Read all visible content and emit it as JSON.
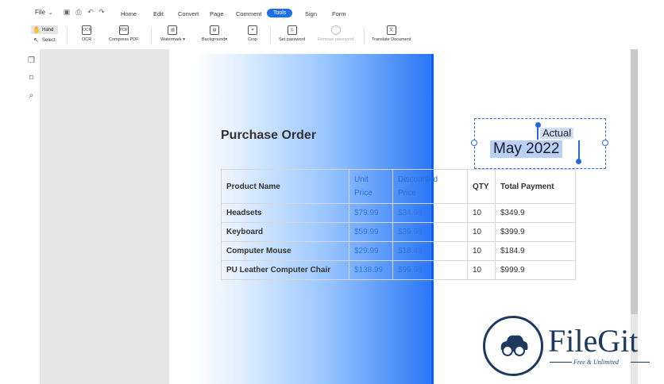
{
  "menubar": {
    "file_label": "File",
    "caret": "⌄",
    "quick_icons": [
      "save-icon",
      "print-icon",
      "undo-icon",
      "redo-icon"
    ],
    "items": [
      "Home",
      "Edit",
      "Convert",
      "Page",
      "Comment",
      "Tools",
      "Sign",
      "Form"
    ],
    "active": "Tools"
  },
  "toolbar": {
    "hand_label": "Hand",
    "select_label": "Select",
    "tools": [
      {
        "label": "OCR",
        "icon": "ocr-icon",
        "glyph": "OCR"
      },
      {
        "label": "Compress PDF",
        "icon": "compress-pdf-icon",
        "glyph": "PDF"
      },
      {
        "label": "Watermark ▾",
        "icon": "watermark-icon",
        "glyph": "▨"
      },
      {
        "label": "Background▾",
        "icon": "background-icon",
        "glyph": "▤"
      },
      {
        "label": "Crop",
        "icon": "crop-icon",
        "glyph": "⌗"
      },
      {
        "label": "Set password",
        "icon": "lock-icon",
        "glyph": "⊡"
      },
      {
        "label": "Remove password",
        "icon": "remove-password-icon",
        "glyph": "–"
      },
      {
        "label": "Translate Document",
        "icon": "translate-icon",
        "glyph": "文"
      }
    ]
  },
  "leftrail": {
    "icons": [
      "pages-icon",
      "bookmark-icon",
      "search-icon"
    ]
  },
  "document": {
    "title": "Purchase Order",
    "table": {
      "headers": [
        {
          "line1": "Product Name",
          "line2": ""
        },
        {
          "line1": "Unit",
          "line2": "Price"
        },
        {
          "line1": "Discounted",
          "line2": "Price"
        },
        {
          "line1": "QTY",
          "line2": ""
        },
        {
          "line1": "Total Payment",
          "line2": ""
        }
      ],
      "rows": [
        [
          "Headsets",
          "$79.99",
          "$34.99",
          "10",
          "$349.9"
        ],
        [
          "Keyboard",
          "$59.99",
          "$39.99",
          "10",
          "$399.9"
        ],
        [
          "Computer Mouse",
          "$29.99",
          "$18.49",
          "10",
          "$184.9"
        ],
        [
          "PU Leather Computer Chair",
          "$138.99",
          "$99.99",
          "10",
          "$999.9"
        ]
      ]
    },
    "selected_text": {
      "label": "Actual",
      "date": "May 2022"
    }
  },
  "watermark": {
    "brand": "FileGit",
    "tagline": "Free & Unlimited"
  },
  "colors": {
    "accent": "#1f6fe5",
    "selection": "#2a66d6",
    "brand": "#1d3a5e"
  }
}
